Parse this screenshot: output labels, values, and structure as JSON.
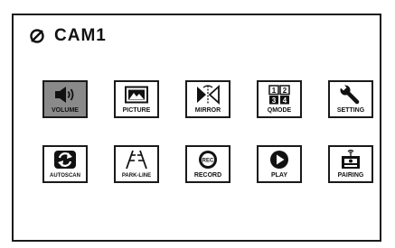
{
  "header": {
    "title": "CAM1",
    "icon": "no-camera-icon"
  },
  "menu": {
    "items": [
      {
        "label": "VOLUME",
        "icon": "speaker-icon",
        "selected": true
      },
      {
        "label": "PICTURE",
        "icon": "picture-icon",
        "selected": false
      },
      {
        "label": "MIRROR",
        "icon": "mirror-icon",
        "selected": false
      },
      {
        "label": "QMODE",
        "icon": "quad-grid-icon",
        "selected": false
      },
      {
        "label": "SETTING",
        "icon": "wrench-icon",
        "selected": false
      },
      {
        "label": "AUTOSCAN",
        "icon": "autoscan-icon",
        "selected": false
      },
      {
        "label": "PARK-LINE",
        "icon": "park-line-icon",
        "selected": false
      },
      {
        "label": "RECORD",
        "icon": "record-icon",
        "selected": false
      },
      {
        "label": "PLAY",
        "icon": "play-icon",
        "selected": false
      },
      {
        "label": "PAIRING",
        "icon": "pairing-icon",
        "selected": false
      }
    ],
    "qmode_digits": [
      "1",
      "2",
      "3",
      "4"
    ],
    "record_badge": "REC"
  },
  "colors": {
    "border": "#1a1a1a",
    "selected_bg": "#8a8a8a",
    "background": "#ffffff"
  }
}
